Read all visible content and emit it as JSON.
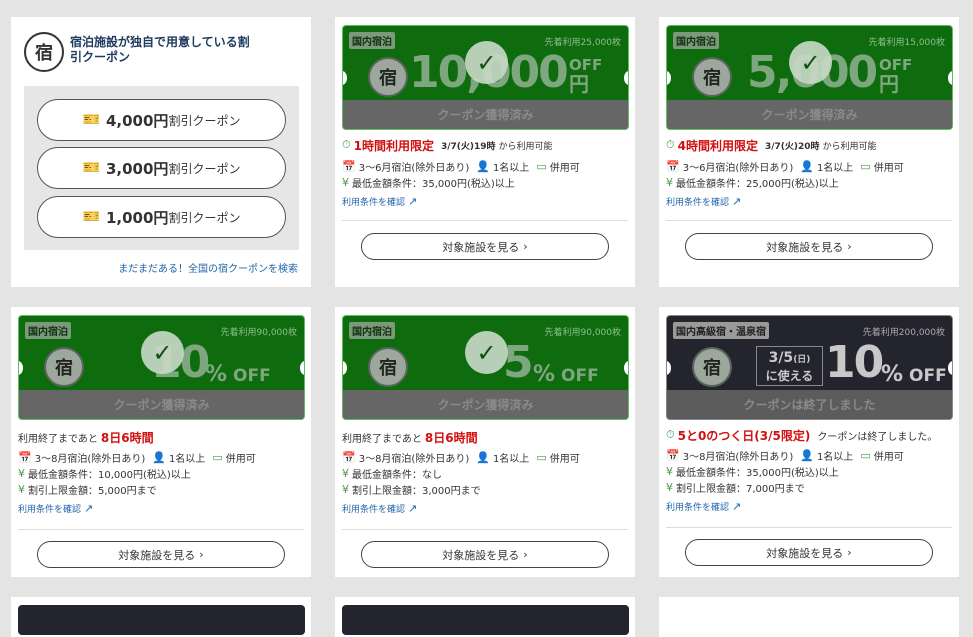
{
  "intro": {
    "logo_char": "宿",
    "title": "宿泊施設が独自で用意している割引クーポン",
    "buttons": [
      {
        "amount": "4,000円",
        "suffix": "割引クーポン"
      },
      {
        "amount": "3,000円",
        "suffix": "割引クーポン"
      },
      {
        "amount": "1,000円",
        "suffix": "割引クーポン"
      }
    ],
    "search_link": "まだまだある！全国の宿クーポンを検索"
  },
  "coupons": [
    {
      "category": "国内宿泊",
      "limit": "先着利用25,000枚",
      "amount": "10,000",
      "unit": "円",
      "off": "OFF",
      "status": "クーポン獲得済み",
      "headline_red": "1時間利用限定",
      "headline_rest": "3/7(火)19時",
      "headline_tail": "から利用可能",
      "stay": "3〜6月宿泊(除外日あり)",
      "people": "1名以上",
      "combo": "併用可",
      "conditions": [
        "最低金額条件：35,000円(税込)以上"
      ],
      "link": "利用条件を確認",
      "view": "対象施設を見る"
    },
    {
      "category": "国内宿泊",
      "limit": "先着利用15,000枚",
      "amount": "5,000",
      "unit": "円",
      "off": "OFF",
      "status": "クーポン獲得済み",
      "headline_red": "4時間利用限定",
      "headline_rest": "3/7(火)20時",
      "headline_tail": "から利用可能",
      "stay": "3〜6月宿泊(除外日あり)",
      "people": "1名以上",
      "combo": "併用可",
      "conditions": [
        "最低金額条件：25,000円(税込)以上"
      ],
      "link": "利用条件を確認",
      "view": "対象施設を見る"
    },
    {
      "category": "国内宿泊",
      "limit": "先着利用90,000枚",
      "amount": "10",
      "unit": "%",
      "off": "OFF",
      "status": "クーポン獲得済み",
      "headline_pre": "利用終了まであと",
      "headline_red": "8日6時間",
      "stay": "3〜8月宿泊(除外日あり)",
      "people": "1名以上",
      "combo": "併用可",
      "conditions": [
        "最低金額条件：10,000円(税込)以上",
        "割引上限金額：5,000円まで"
      ],
      "link": "利用条件を確認",
      "view": "対象施設を見る"
    },
    {
      "category": "国内宿泊",
      "limit": "先着利用90,000枚",
      "amount": "5",
      "unit": "%",
      "off": "OFF",
      "status": "クーポン獲得済み",
      "headline_pre": "利用終了まであと",
      "headline_red": "8日6時間",
      "stay": "3〜8月宿泊(除外日あり)",
      "people": "1名以上",
      "combo": "併用可",
      "conditions": [
        "最低金額条件：なし",
        "割引上限金額：3,000円まで"
      ],
      "link": "利用条件を確認",
      "view": "対象施設を見る"
    },
    {
      "category": "国内高級宿・温泉宿",
      "limit": "先着利用200,000枚",
      "date_line1": "3/5",
      "date_day": "(日)",
      "date_line2": "に使える",
      "amount": "10",
      "unit": "%",
      "off": "OFF",
      "status": "クーポンは終了しました",
      "headline_red": "5と0のつく日(3/5限定)",
      "headline_tail": "クーポンは終了しました。",
      "stay": "3〜8月宿泊(除外日あり)",
      "people": "1名以上",
      "combo": "併用可",
      "conditions": [
        "最低金額条件：35,000円(税込)以上",
        "割引上限金額：7,000円まで"
      ],
      "link": "利用条件を確認",
      "view": "対象施設を見る"
    }
  ],
  "colors": {
    "ticket_green": "#0e6b0e",
    "ticket_dark": "#24242e",
    "accent_red": "#d10f0f",
    "link_blue": "#2266aa"
  }
}
